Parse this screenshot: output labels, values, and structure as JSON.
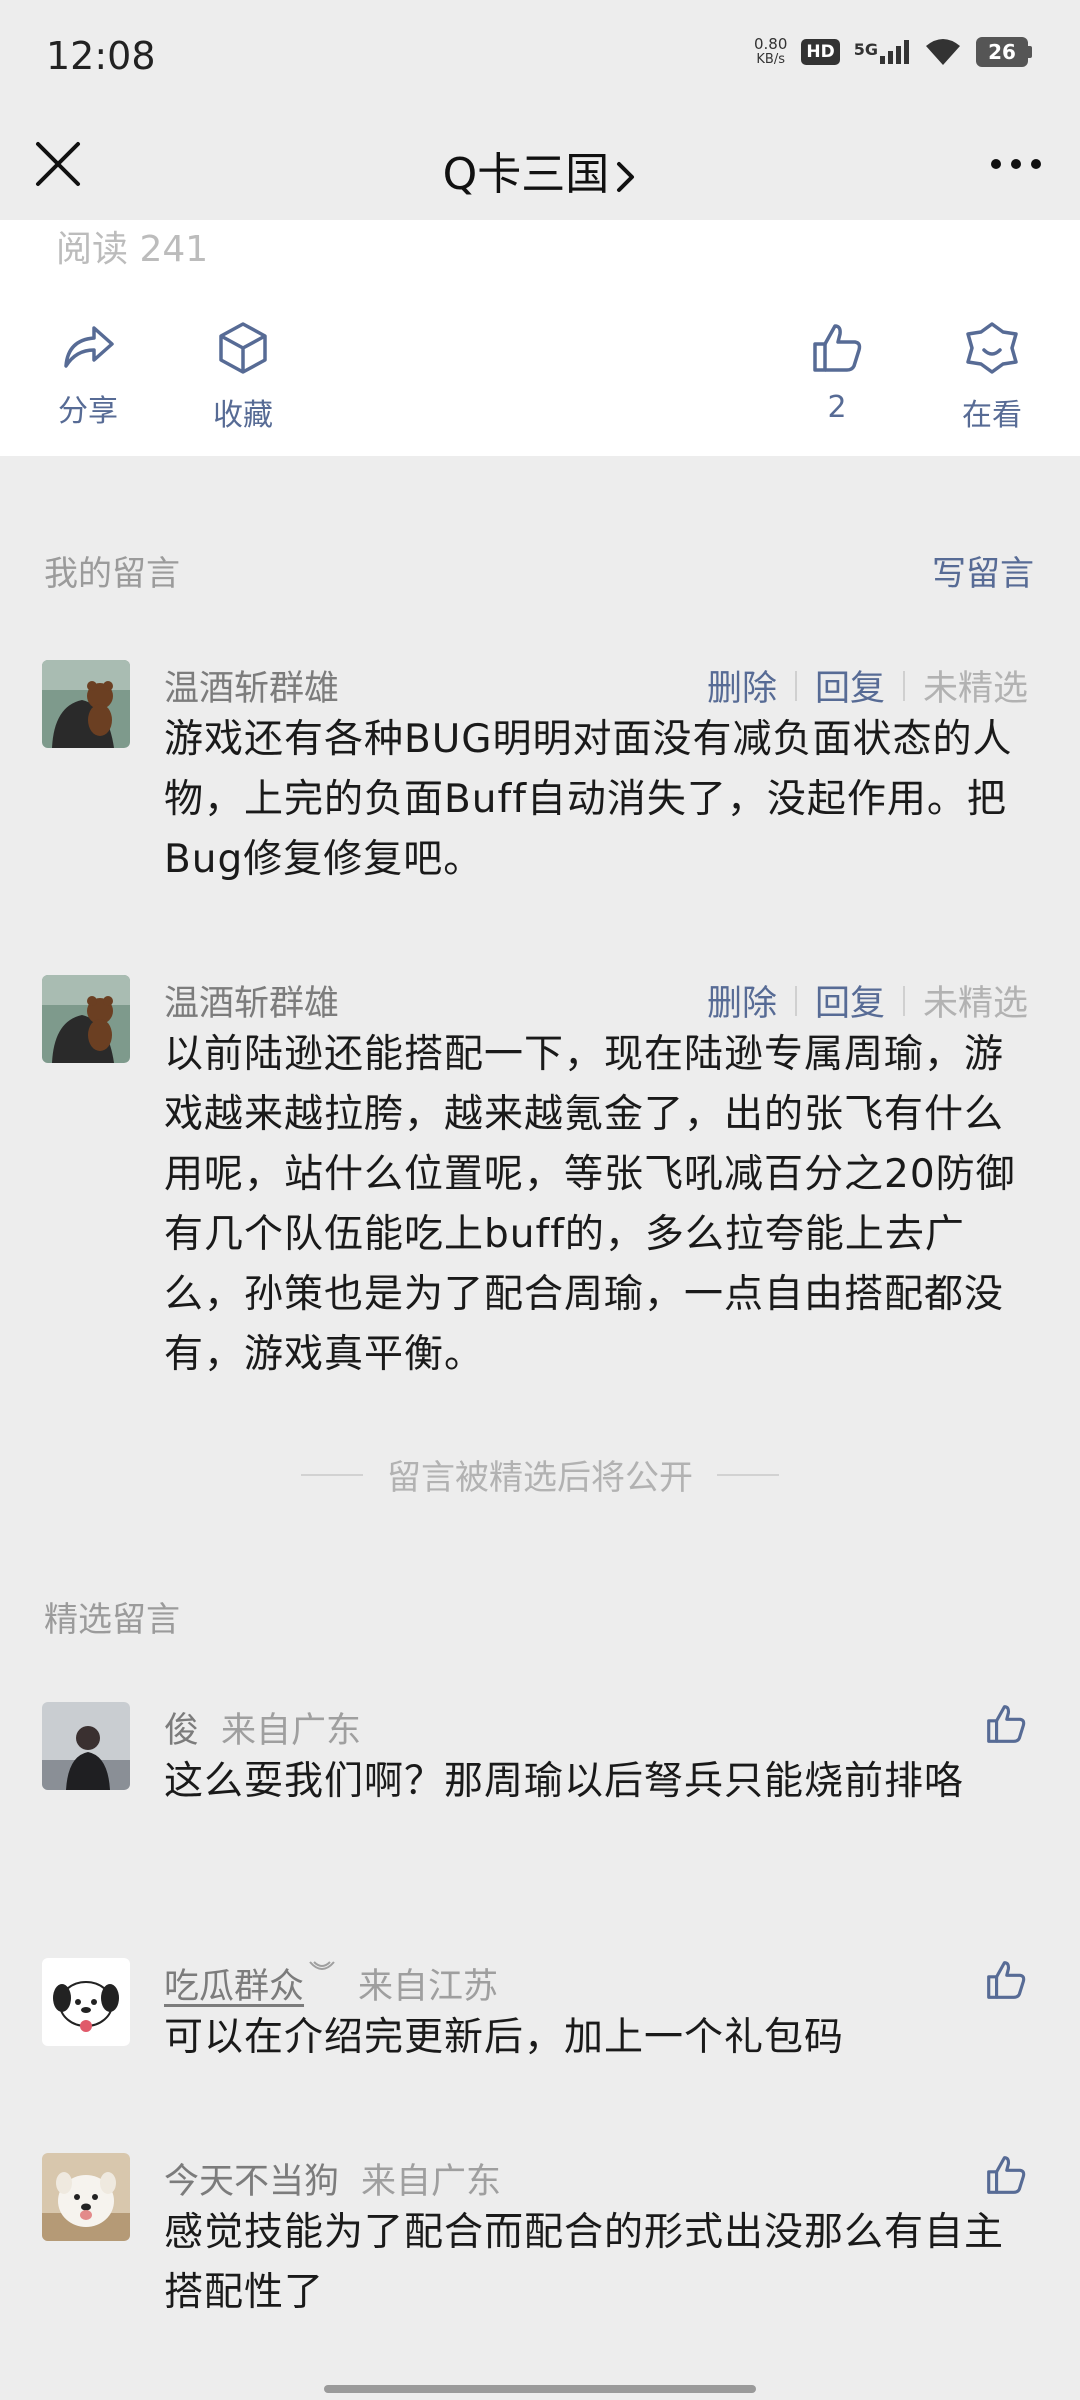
{
  "status_bar": {
    "time": "12:08",
    "net_speed_value": "0.80",
    "net_speed_unit": "KB/s",
    "hd": "HD",
    "network": "5G",
    "battery": "26"
  },
  "nav": {
    "title": "Q卡三国",
    "close_icon": "close-icon",
    "more_icon": "more-icon"
  },
  "article": {
    "read_count": "阅读 241",
    "actions": {
      "share": "分享",
      "favorite": "收藏",
      "like_count": "2",
      "watching": "在看"
    }
  },
  "my_comments": {
    "title": "我的留言",
    "write": "写留言",
    "actions": {
      "delete": "删除",
      "reply": "回复",
      "not_featured": "未精选"
    },
    "items": [
      {
        "name": "温酒斩群雄",
        "text": "游戏还有各种BUG明明对面没有减负面状态的人物，上完的负面Buff自动消失了，没起作用。把Bug修复修复吧。"
      },
      {
        "name": "温酒斩群雄",
        "text": "以前陆逊还能搭配一下，现在陆逊专属周瑜，游戏越来越拉胯，越来越氪金了，出的张飞有什么用呢，站什么位置呢，等张飞吼减百分之20防御有几个队伍能吃上buff的，多么拉夸能上去广么，孙策也是为了配合周瑜，一点自由搭配都没有，游戏真平衡。"
      }
    ],
    "note": "留言被精选后将公开"
  },
  "featured": {
    "title": "精选留言",
    "items": [
      {
        "name": "俊",
        "location": "来自广东",
        "text": "这么耍我们啊？那周瑜以后弩兵只能烧前排咯"
      },
      {
        "name": "吃瓜群众",
        "location": "来自江苏",
        "text": "可以在介绍完更新后，加上一个礼包码"
      },
      {
        "name": "今天不当狗",
        "location": "来自广东",
        "text": "感觉技能为了配合而配合的形式出没那么有自主搭配性了"
      }
    ]
  },
  "colors": {
    "link": "#576b95",
    "background": "#ededed",
    "muted": "#b2b2b2"
  }
}
